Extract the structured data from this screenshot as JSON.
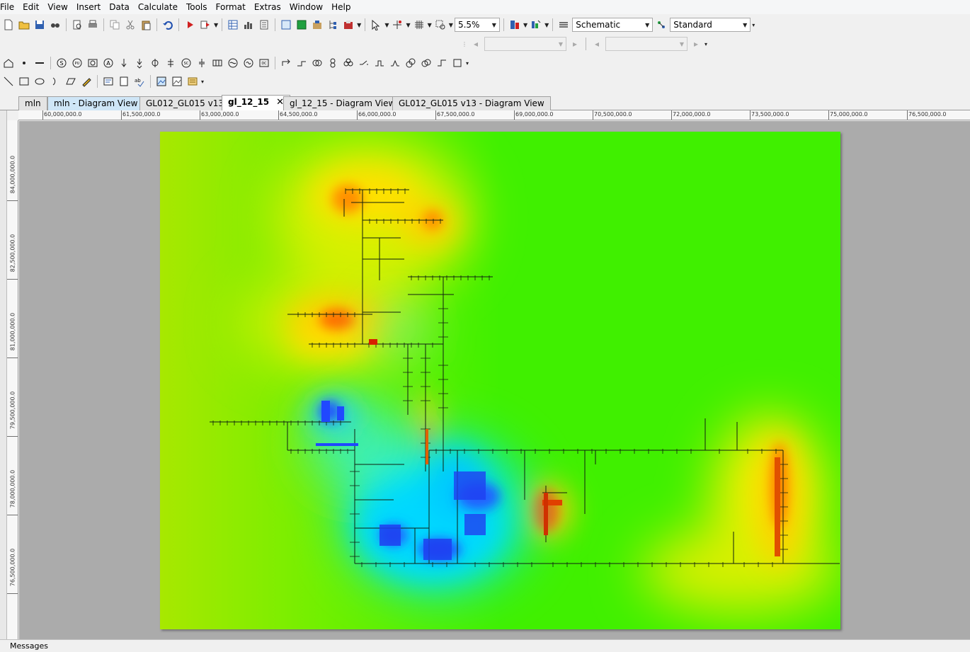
{
  "menu": {
    "items": [
      "File",
      "Edit",
      "View",
      "Insert",
      "Data",
      "Calculate",
      "Tools",
      "Format",
      "Extras",
      "Window",
      "Help"
    ]
  },
  "toolbar": {
    "zoom_value": "5.5%",
    "view_mode": "Schematic",
    "style": "Standard"
  },
  "tabs": [
    {
      "label": "mln",
      "active": false
    },
    {
      "label": "mln - Diagram View",
      "active": false
    },
    {
      "label": "GL012_GL015 v13",
      "active": false
    },
    {
      "label": "gl_12_15",
      "active": true
    },
    {
      "label": "gl_12_15 - Diagram View",
      "active": false
    },
    {
      "label": "GL012_GL015 v13 - Diagram View",
      "active": false
    }
  ],
  "ruler": {
    "horizontal": [
      "60,000,000.0",
      "61,500,000.0",
      "63,000,000.0",
      "64,500,000.0",
      "66,000,000.0",
      "67,500,000.0",
      "69,000,000.0",
      "70,500,000.0",
      "72,000,000.0",
      "73,500,000.0",
      "75,000,000.0",
      "76,500,000.0"
    ],
    "vertical": [
      "84,000,000.0",
      "82,500,000.0",
      "81,000,000.0",
      "79,500,000.0",
      "78,000,000.0",
      "76,500,000.0"
    ]
  },
  "status": {
    "messages_label": "Messages"
  },
  "colors": {
    "background_field": "#3cf000",
    "hot": "#ff3000",
    "cold": "#1040ff"
  }
}
